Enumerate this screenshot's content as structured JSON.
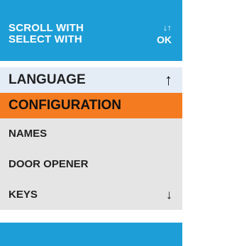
{
  "colors": {
    "header_bg": "#1e9ed6",
    "selected_bg": "#f47b20",
    "menu_bg": "#e5e5e5"
  },
  "header": {
    "hint_scroll": "SCROLL WITH",
    "hint_select": "SELECT WITH",
    "scroll_key": "↓↑",
    "select_key": "OK"
  },
  "menu": {
    "items": [
      {
        "label": "LANGUAGE"
      },
      {
        "label": "CONFIGURATION",
        "selected": true
      },
      {
        "label": "NAMES"
      },
      {
        "label": "DOOR OPENER"
      },
      {
        "label": "KEYS"
      }
    ],
    "up_arrow": "↑",
    "down_arrow": "↓"
  }
}
